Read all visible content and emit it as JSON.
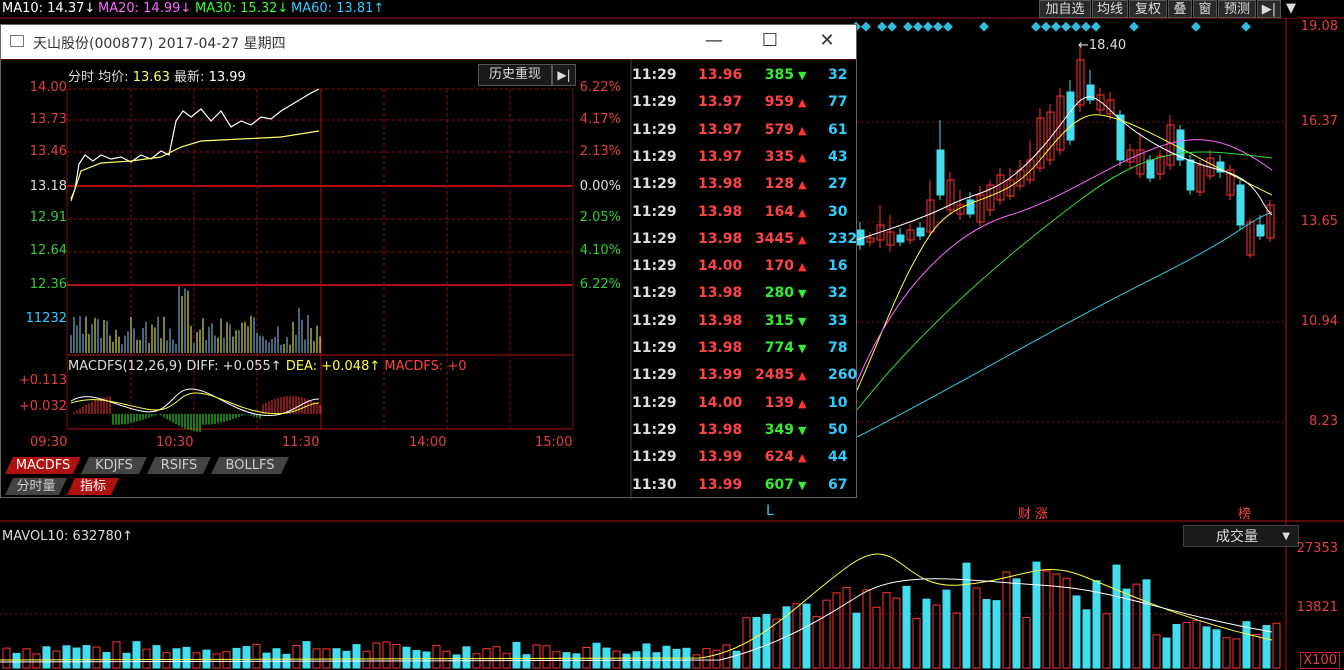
{
  "top_bar": {
    "ma": [
      {
        "label": "MA10: 14.37↓",
        "color": "#ffffff"
      },
      {
        "label": "MA20: 14.99↓",
        "color": "#ff66ff"
      },
      {
        "label": "MA30: 15.32↓",
        "color": "#33ff33"
      },
      {
        "label": "MA60: 13.81↑",
        "color": "#33ccff"
      }
    ],
    "buttons": [
      "加自选",
      "均线",
      "复权",
      "叠",
      "窗",
      "预测"
    ]
  },
  "main_chart": {
    "price_labels": [
      "19.08",
      "16.37",
      "13.65",
      "10.94",
      "8.23"
    ],
    "high_marker": "←18.40",
    "markers": [
      "L",
      "财 涨",
      "榜"
    ]
  },
  "volume": {
    "title": "MAVOL10: 632780↑",
    "dropdown": "成交量",
    "labels": [
      "27353",
      "13821"
    ],
    "unit": "X100"
  },
  "window": {
    "title": "天山股份(000877) 2017-04-27 星期四",
    "info_label": "分时",
    "avg_label": "均价:",
    "avg_value": "13.63",
    "last_label": "最新:",
    "last_value": "13.99",
    "history_button": "历史重现",
    "left_prices": [
      "14.00",
      "13.73",
      "13.46",
      "13.18",
      "12.91",
      "12.64",
      "12.36"
    ],
    "right_pcts": [
      "6.22%",
      "4.17%",
      "2.13%",
      "0.00%",
      "2.05%",
      "4.10%",
      "6.22%"
    ],
    "vol_label": "11232",
    "macd_title": "MACDFS(12,26,9)",
    "macd_diff": "DIFF: +0.055↑",
    "macd_dea": "DEA: +0.048↑",
    "macd_fs": "MACDFS: +0",
    "macd_labels": [
      "+0.113",
      "+0.032"
    ],
    "time_ticks": [
      "09:30",
      "10:30",
      "11:30",
      "14:00",
      "15:00"
    ],
    "indicator_tabs": [
      "MACDFS",
      "KDJFS",
      "RSIFS",
      "BOLLFS"
    ],
    "bottom_tabs": [
      "分时量",
      "指标"
    ]
  },
  "ticks": [
    {
      "time": "11:29",
      "price": "13.96",
      "vol": "385",
      "dir": "down",
      "n": "32"
    },
    {
      "time": "11:29",
      "price": "13.97",
      "vol": "959",
      "dir": "up",
      "n": "77"
    },
    {
      "time": "11:29",
      "price": "13.97",
      "vol": "579",
      "dir": "up",
      "n": "61"
    },
    {
      "time": "11:29",
      "price": "13.97",
      "vol": "335",
      "dir": "up",
      "n": "43"
    },
    {
      "time": "11:29",
      "price": "13.98",
      "vol": "128",
      "dir": "up",
      "n": "27"
    },
    {
      "time": "11:29",
      "price": "13.98",
      "vol": "164",
      "dir": "up",
      "n": "30"
    },
    {
      "time": "11:29",
      "price": "13.98",
      "vol": "3445",
      "dir": "up",
      "n": "232"
    },
    {
      "time": "11:29",
      "price": "14.00",
      "vol": "170",
      "dir": "up",
      "n": "16"
    },
    {
      "time": "11:29",
      "price": "13.98",
      "vol": "280",
      "dir": "down",
      "n": "32"
    },
    {
      "time": "11:29",
      "price": "13.98",
      "vol": "315",
      "dir": "down",
      "n": "33"
    },
    {
      "time": "11:29",
      "price": "13.98",
      "vol": "774",
      "dir": "down",
      "n": "78"
    },
    {
      "time": "11:29",
      "price": "13.99",
      "vol": "2485",
      "dir": "up",
      "n": "260"
    },
    {
      "time": "11:29",
      "price": "14.00",
      "vol": "139",
      "dir": "up",
      "n": "10"
    },
    {
      "time": "11:29",
      "price": "13.98",
      "vol": "349",
      "dir": "down",
      "n": "50"
    },
    {
      "time": "11:29",
      "price": "13.99",
      "vol": "624",
      "dir": "up",
      "n": "44"
    },
    {
      "time": "11:30",
      "price": "13.99",
      "vol": "607",
      "dir": "down",
      "n": "67"
    }
  ]
}
